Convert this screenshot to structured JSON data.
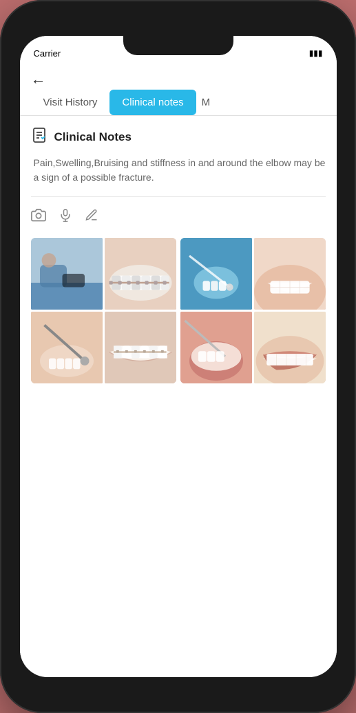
{
  "status": {
    "carrier": "Carrier",
    "signal": "●●●●"
  },
  "header": {
    "back_label": "←"
  },
  "tabs": {
    "visit_history_label": "Visit History",
    "clinical_notes_label": "Clinical notes",
    "more_label": "M"
  },
  "section": {
    "icon_label": "📋",
    "title": "Clinical Notes",
    "notes_text": "Pain,Swelling,Bruising and stiffness in and around the elbow may be a sign of a possible fracture."
  },
  "toolbar": {
    "camera_icon": "📷",
    "mic_icon": "🎙",
    "pencil_icon": "✏️"
  },
  "photos": {
    "grid1": [
      {
        "id": "dentist-chair",
        "class": "img-dentist-chair"
      },
      {
        "id": "teeth-braces",
        "class": "img-teeth-braces"
      },
      {
        "id": "dental-tool",
        "class": "img-dental-tool"
      },
      {
        "id": "braces2",
        "class": "img-braces2"
      }
    ],
    "grid2": [
      {
        "id": "dental-exam1",
        "class": "img-dental-exam1"
      },
      {
        "id": "smile1",
        "class": "img-smile1"
      },
      {
        "id": "dental-exam2",
        "class": "img-dental-exam2"
      },
      {
        "id": "smile2",
        "class": "img-smile2"
      }
    ]
  }
}
